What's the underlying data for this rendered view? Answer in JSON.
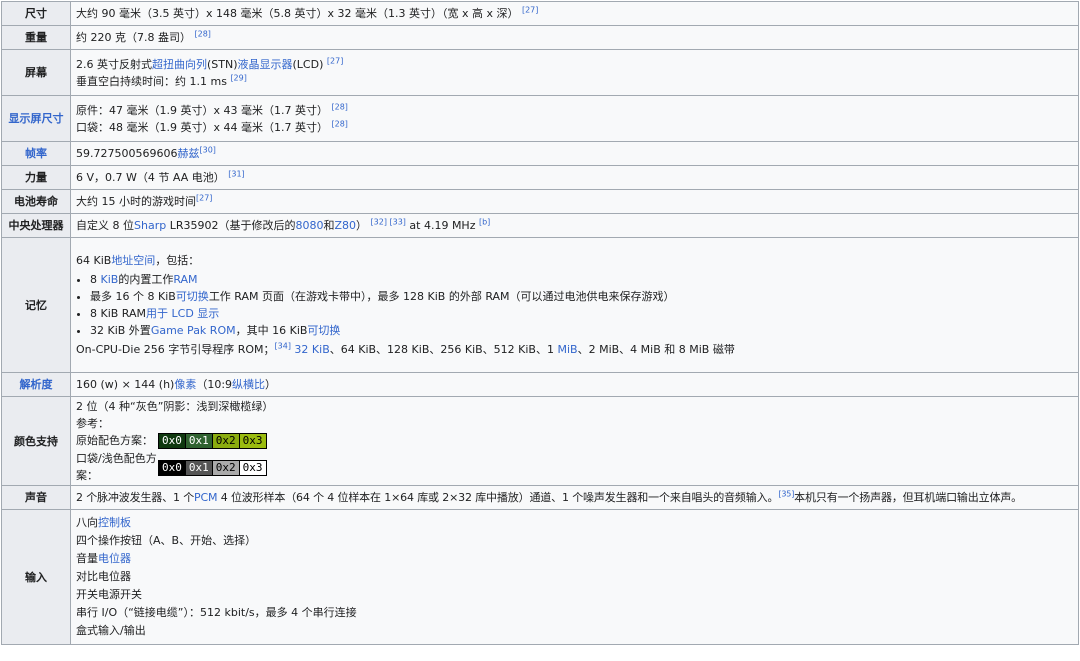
{
  "rows": [
    {
      "key": "size",
      "label": "尺寸",
      "label_link": false,
      "text": "大约 90 毫米（3.5 英寸）x 148 毫米（5.8 英寸）x 32 毫米（1.3 英寸）（宽 x 高 x 深）",
      "ref": "[27]"
    },
    {
      "key": "weight",
      "label": "重量",
      "label_link": false,
      "text": "约 220 克（7.8 盎司）",
      "ref": "[28]"
    },
    {
      "key": "screen",
      "label": "屏幕",
      "label_link": false,
      "line1_pre": "2.6 英寸反射式",
      "line1_link1": "超扭曲向列",
      "line1_mid": "(STN)",
      "line1_link2": "液晶显示器",
      "line1_post": "(LCD)",
      "line1_ref": "[27]",
      "line2": "垂直空白持续时间：约 1.1 ms",
      "line2_ref": "[29]"
    },
    {
      "key": "display_size",
      "label": "显示屏尺寸",
      "label_link": true,
      "line1": "原件：47 毫米（1.9 英寸）x 43 毫米（1.7 英寸）",
      "line1_ref": "[28]",
      "line2": "口袋：48 毫米（1.9 英寸）x 44 毫米（1.7 英寸）",
      "line2_ref": "[28]"
    },
    {
      "key": "frame_rate",
      "label": "帧率",
      "label_link": true,
      "text": "59.727500569606",
      "link": "赫兹",
      "ref": "[30]"
    },
    {
      "key": "power",
      "label": "力量",
      "label_link": false,
      "text": "6 V，0.7 W（4 节 AA 电池）",
      "ref": "[31]"
    },
    {
      "key": "battery",
      "label": "电池寿命",
      "label_link": false,
      "text": "大约 15 小时的游戏时间",
      "ref": "[27]"
    },
    {
      "key": "cpu",
      "label": "中央处理器",
      "label_link": false,
      "pre": "自定义 8 位",
      "link1": "Sharp",
      "mid1": " LR35902（基于修改后的",
      "link2": "8080",
      "mid2": "和",
      "link3": "Z80",
      "mid3": "）",
      "refs": "[32] [33]",
      "post": " at 4.19 MHz ",
      "ref_b": "[b]"
    },
    {
      "key": "memory",
      "label": "记忆",
      "label_link": false,
      "intro_pre": "64 KiB",
      "intro_link": "地址空间",
      "intro_post": "，包括：",
      "b1_pre": "8 ",
      "b1_link1": "KiB",
      "b1_mid": "的内置工作",
      "b1_link2": "RAM",
      "b2_pre": "最多 16 个 8 KiB",
      "b2_link": "可切换",
      "b2_post": "工作 RAM 页面（在游戏卡带中），最多 128 KiB 的外部 RAM（可以通过电池供电来保存游戏）",
      "b3_pre": "8 KiB RAM",
      "b3_link": "用于 LCD 显示",
      "b4_pre": "32 KiB 外置",
      "b4_link1": "Game Pak ROM",
      "b4_mid": "，其中 16 KiB",
      "b4_link2": "可切换",
      "out_pre": "On-CPU-Die 256 字节引导程序 ROM；",
      "out_ref": "[34]",
      "out_link1": " 32 KiB",
      "out_mid": "、64 KiB、128 KiB、256 KiB、512 KiB、1 ",
      "out_link2": "MiB",
      "out_post": "、2 MiB、4 MiB 和 8 MiB 磁带"
    },
    {
      "key": "resolution",
      "label": "解析度",
      "label_link": true,
      "pre": "160 (w) × 144 (h)",
      "link1": "像素",
      "mid": "（10:9",
      "link2": "纵横比",
      "post": "）"
    },
    {
      "key": "color",
      "label": "颜色支持",
      "label_link": false,
      "line1": "2 位（4 种“灰色”阴影：浅到深橄榄绿）",
      "line2": "参考：",
      "pal1_label": "原始配色方案：",
      "pal2_label": "口袋/浅色配色方案：",
      "pal1": [
        {
          "code": "0x0",
          "bg": "#0f380f",
          "fg": "#ffffff"
        },
        {
          "code": "0x1",
          "bg": "#306230",
          "fg": "#ffffff"
        },
        {
          "code": "0x2",
          "bg": "#8bac0f",
          "fg": "#000000"
        },
        {
          "code": "0x3",
          "bg": "#9bbc0f",
          "fg": "#000000"
        }
      ],
      "pal2": [
        {
          "code": "0x0",
          "bg": "#000000",
          "fg": "#ffffff"
        },
        {
          "code": "0x1",
          "bg": "#555555",
          "fg": "#ffffff"
        },
        {
          "code": "0x2",
          "bg": "#aaaaaa",
          "fg": "#000000"
        },
        {
          "code": "0x3",
          "bg": "#ffffff",
          "fg": "#000000"
        }
      ]
    },
    {
      "key": "sound",
      "label": "声音",
      "label_link": false,
      "pre": "2 个脉冲波发生器、1 个",
      "link": "PCM",
      "mid": " 4 位波形样本（64 个 4 位样本在 1×64 库或 2×32 库中播放）通道、1 个噪声发生器和一个来自唱头的音频输入。",
      "ref": "[35]",
      "post": "本机只有一个扬声器，但耳机端口输出立体声。"
    },
    {
      "key": "input",
      "label": "输入",
      "label_link": false,
      "l1_pre": "八向",
      "l1_link": "控制板",
      "l2": "四个操作按钮（A、B、开始、选择）",
      "l3_pre": "音量",
      "l3_link": "电位器",
      "l4": "对比电位器",
      "l5": "开关电源开关",
      "l6": "串行 I/O（“链接电缆”）：512 kbit/s，最多 4 个串行连接",
      "l7": "盒式输入/输出"
    }
  ]
}
